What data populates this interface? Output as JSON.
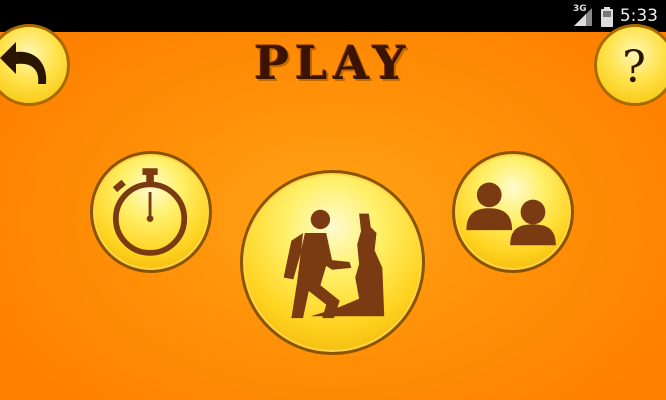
{
  "status_bar": {
    "network": "3G",
    "time": "5:33",
    "icons": [
      "signal-icon",
      "battery-icon"
    ]
  },
  "title": "PLAY",
  "buttons": {
    "back": "back-arrow-icon",
    "help": "question-mark-icon",
    "timed": "stopwatch-icon",
    "climb": "climber-icon",
    "multiplayer": "two-players-icon"
  },
  "colors": {
    "background": "#ff8c00",
    "button_fill": "#ffd320",
    "icon": "#7a3a12"
  }
}
